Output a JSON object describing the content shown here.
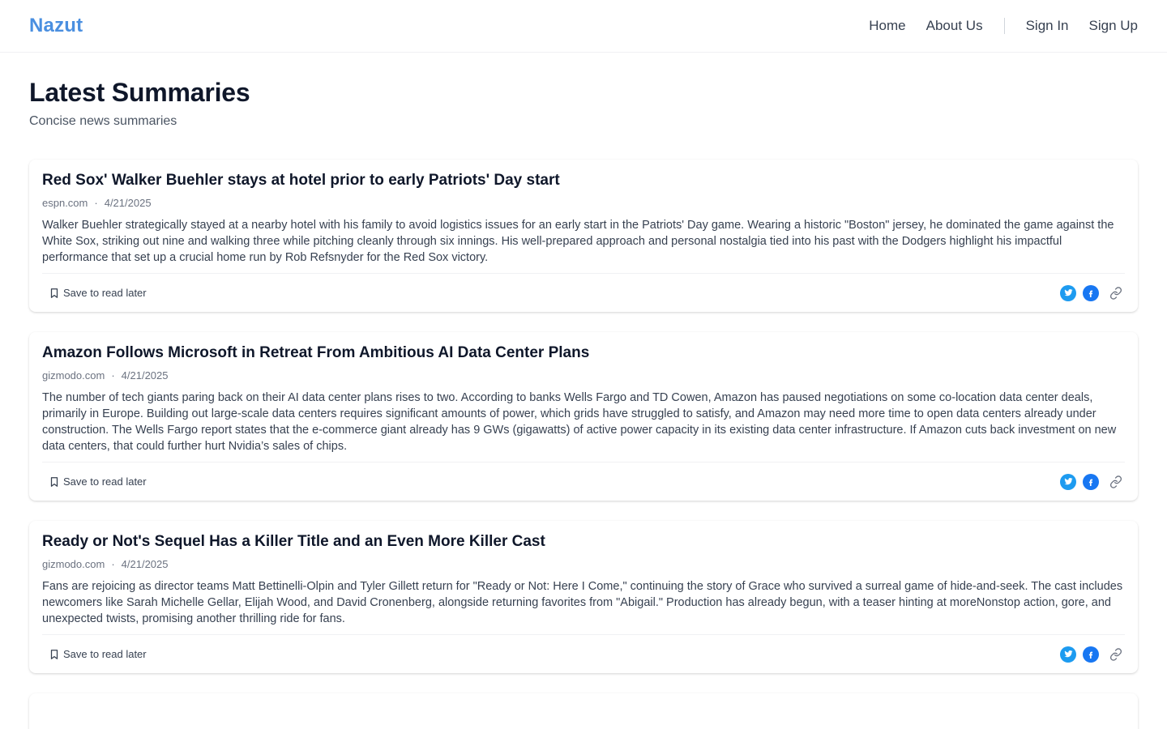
{
  "header": {
    "logo": "Nazut",
    "nav": {
      "home": "Home",
      "about": "About Us",
      "sign_in": "Sign In",
      "sign_up": "Sign Up"
    }
  },
  "page": {
    "title": "Latest Summaries",
    "subtitle": "Concise news summaries"
  },
  "colors": {
    "brand": "#4a8fe0",
    "twitter": "#1d9bf0",
    "facebook": "#1877f2"
  },
  "actions": {
    "save_label": "Save to read later"
  },
  "icons": {
    "save": "bookmark-icon",
    "twitter": "twitter-icon",
    "facebook": "facebook-icon",
    "link": "link-icon"
  },
  "articles": [
    {
      "title": "Red Sox' Walker Buehler stays at hotel prior to early Patriots' Day start",
      "source": "espn.com",
      "date": "4/21/2025",
      "summary": "Walker Buehler strategically stayed at a nearby hotel with his family to avoid logistics issues for an early start in the Patriots' Day game. Wearing a historic \"Boston\" jersey, he dominated the game against the White Sox, striking out nine and walking three while pitching cleanly through six innings. His well-prepared approach and personal nostalgia tied into his past with the Dodgers highlight his impactful performance that set up a crucial home run by Rob Refsnyder for the Red Sox victory."
    },
    {
      "title": "Amazon Follows Microsoft in Retreat From Ambitious AI Data Center Plans",
      "source": "gizmodo.com",
      "date": "4/21/2025",
      "summary": "The number of tech giants paring back on their AI data center plans rises to two. According to banks Wells Fargo and TD Cowen, Amazon has paused negotiations on some co-location data center deals, primarily in Europe. Building out large-scale data centers requires significant amounts of power, which grids have struggled to satisfy, and Amazon may need more time to open data centers already under construction. The Wells Fargo report states that the e-commerce giant already has 9 GWs (gigawatts) of active power capacity in its existing data center infrastructure. If Amazon cuts back investment on new data centers, that could further hurt Nvidia’s sales of chips."
    },
    {
      "title": "Ready or Not's Sequel Has a Killer Title and an Even More Killer Cast",
      "source": "gizmodo.com",
      "date": "4/21/2025",
      "summary": "Fans are rejoicing as director teams Matt Bettinelli-Olpin and Tyler Gillett return for \"Ready or Not: Here I Come,\" continuing the story of Grace who survived a surreal game of hide-and-seek. The cast includes newcomers like Sarah Michelle Gellar, Elijah Wood, and David Cronenberg, alongside returning favorites from \"Abigail.\" Production has already begun, with a teaser hinting at moreNonstop action, gore, and unexpected twists, promising another thrilling ride for fans."
    }
  ]
}
